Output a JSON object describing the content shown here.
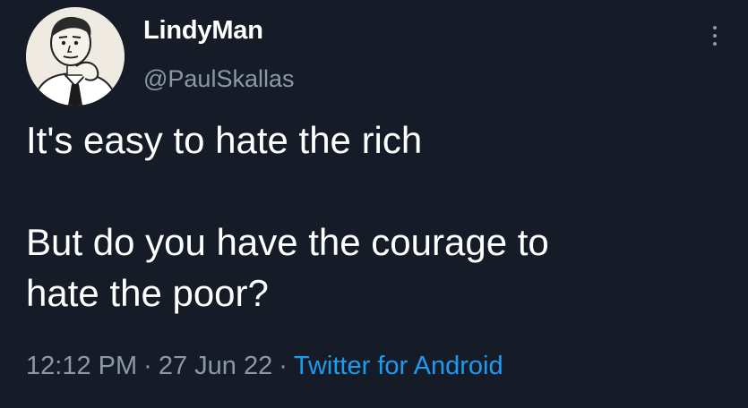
{
  "author": {
    "display_name": "LindyMan",
    "handle": "@PaulSkallas",
    "avatar_icon": "cartoon-man-avatar-icon"
  },
  "more_icon": "vertical-ellipsis-icon",
  "tweet": {
    "line1": "It's easy to hate the rich",
    "line2": "But do you have the courage to",
    "line3": "hate the poor?"
  },
  "meta": {
    "time": "12:12 PM",
    "separator": "·",
    "date": "27 Jun 22",
    "source": "Twitter for Android"
  },
  "colors": {
    "background": "#151c27",
    "text": "#ffffff",
    "muted": "#8b98a5",
    "link": "#1d9bf0"
  }
}
